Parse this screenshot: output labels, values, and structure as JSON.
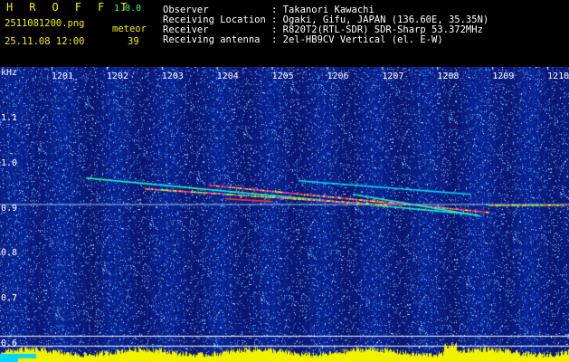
{
  "header": {
    "app_name": "H R O F F T",
    "app_version": "1.0.0",
    "filename": "2511081200.png",
    "datetime": "25.11.08 12:00",
    "meteor_label": "meteor",
    "meteor_count": "39",
    "info": [
      {
        "label": "Observer",
        "value": ": Takanori Kawachi"
      },
      {
        "label": "Receiving Location",
        "value": ": Ogaki, Gifu, JAPAN (136.60E, 35.35N)"
      },
      {
        "label": "Receiver",
        "value": ": R820T2(RTL-SDR) SDR-Sharp 53.372MHz"
      },
      {
        "label": "Receiving antenna",
        "value": ": 2el-HB9CV Vertical (el. E-W)"
      }
    ]
  },
  "axes": {
    "y_unit": "kHz",
    "y_ticks": [
      "1.1",
      "1.0",
      "0.9",
      "0.8",
      "0.7",
      "0.6"
    ],
    "x_ticks": [
      "1201",
      "1202",
      "1203",
      "1204",
      "1205",
      "1206",
      "1207",
      "1208",
      "1209",
      "1210"
    ]
  },
  "colors": {
    "background": "#10208c",
    "accent_yellow": "#f2f200",
    "meteor_count_green": "#33ff66",
    "baseline_cyan": "#00d8ff"
  }
}
